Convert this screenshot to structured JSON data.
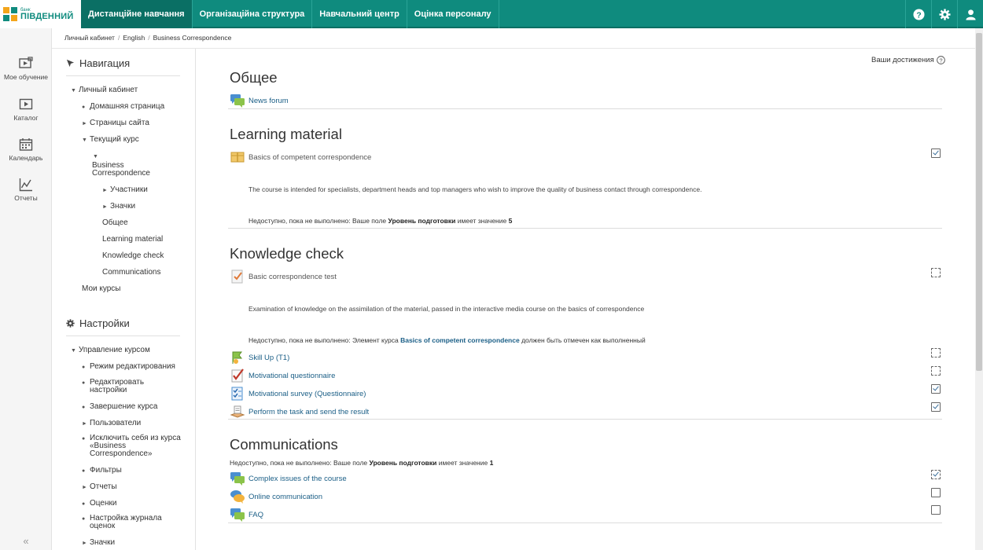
{
  "header": {
    "logo_small": "банк",
    "logo_big": "ПІВДЕННИЙ",
    "nav": [
      {
        "label": "Дистанційне навчання"
      },
      {
        "label": "Організаційна структура"
      },
      {
        "label": "Навчальний центр"
      },
      {
        "label": "Оцінка персоналу"
      }
    ]
  },
  "rail": {
    "items": [
      {
        "label": "Мое обучение",
        "icon": "play-board-icon"
      },
      {
        "label": "Каталог",
        "icon": "play-icon"
      },
      {
        "label": "Календарь",
        "icon": "calendar-icon"
      },
      {
        "label": "Отчеты",
        "icon": "chart-icon"
      }
    ],
    "collapse": "«"
  },
  "breadcrumb": [
    "Личный кабинет",
    "English",
    "Business Correspondence"
  ],
  "navigation_block": {
    "title": "Навигация",
    "items": [
      {
        "label": "Личный кабинет"
      },
      {
        "label": "Домашняя страница"
      },
      {
        "label": "Страницы сайта"
      },
      {
        "label": "Текущий курс"
      },
      {
        "label": "Business"
      },
      {
        "label": "Correspondence"
      },
      {
        "label": "Участники"
      },
      {
        "label": "Значки"
      },
      {
        "label": "Общее"
      },
      {
        "label": "Learning material"
      },
      {
        "label": "Knowledge check"
      },
      {
        "label": "Communications"
      },
      {
        "label": "Мои курсы"
      }
    ]
  },
  "settings_block": {
    "title": "Настройки",
    "items": [
      {
        "label": "Управление курсом"
      },
      {
        "label": "Режим редактирования"
      },
      {
        "label": "Редактировать"
      },
      {
        "label": "настройки"
      },
      {
        "label": "Завершение курса"
      },
      {
        "label": "Пользователи"
      },
      {
        "label": "Исключить себя из курса"
      },
      {
        "label": "«Business"
      },
      {
        "label": "Correspondence»"
      },
      {
        "label": "Фильтры"
      },
      {
        "label": "Отчеты"
      },
      {
        "label": "Оценки"
      },
      {
        "label": "Настройка журнала"
      },
      {
        "label": "оценок"
      },
      {
        "label": "Значки"
      }
    ]
  },
  "main": {
    "achievements": "Ваши достижения",
    "sections": [
      {
        "title": "Общее",
        "activities": [
          {
            "label": "News forum",
            "icon": "forum-icon"
          }
        ]
      },
      {
        "title": "Learning material",
        "activities": [
          {
            "label": "Basics of competent correspondence",
            "icon": "package-icon"
          }
        ],
        "description": "The course is intended for specialists, department heads and top managers who wish to improve the quality of business contact through correspondence.",
        "restriction": {
          "prefix": "Недоступно, пока не выполнено: Ваше поле ",
          "field": "Уровень подготовки",
          "middle": " имеет значение ",
          "value": "5"
        }
      },
      {
        "title": "Knowledge check",
        "activities": [
          {
            "label": "Basic correspondence test",
            "icon": "quiz-icon"
          },
          {
            "label": "Skill Up (T1)",
            "icon": "skill-icon"
          },
          {
            "label": "Motivational questionnaire",
            "icon": "questionnaire-icon"
          },
          {
            "label": "Motivational survey (Questionnaire)",
            "icon": "survey-icon"
          },
          {
            "label": "Perform the task and send the result",
            "icon": "assignment-icon"
          }
        ],
        "description": "Examination of knowledge on the assimilation of the material, passed in the interactive media course on the basics of correspondence",
        "restriction": {
          "prefix": "Недоступно, пока не выполнено: Элемент курса ",
          "link": "Basics of competent correspondence",
          "suffix": " должен быть отмечен как выполненный"
        }
      },
      {
        "title": "Communications",
        "restriction": {
          "prefix": "Недоступно, пока не выполнено: Ваше поле ",
          "field": "Уровень подготовки",
          "middle": " имеет значение ",
          "value": "1"
        },
        "activities": [
          {
            "label": "Complex issues of the course",
            "icon": "forum-icon"
          },
          {
            "label": "Online communication",
            "icon": "chat-icon"
          },
          {
            "label": "FAQ",
            "icon": "forum-icon"
          }
        ]
      }
    ]
  },
  "colors": {
    "brand": "#0f8b7e",
    "link": "#1a5e86"
  }
}
